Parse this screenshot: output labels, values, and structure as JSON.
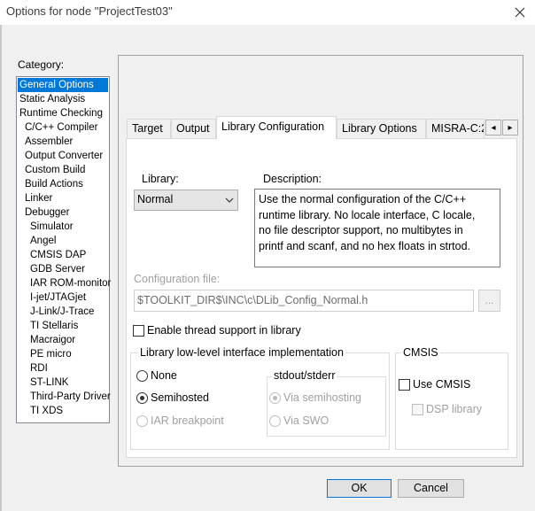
{
  "window": {
    "title": "Options for node \"ProjectTest03\"",
    "close_icon": "close-icon"
  },
  "category": {
    "label": "Category:",
    "items": [
      {
        "label": "General Options",
        "selected": true
      },
      {
        "label": "Static Analysis"
      },
      {
        "label": "Runtime Checking"
      },
      {
        "label": "C/C++ Compiler"
      },
      {
        "label": "Assembler"
      },
      {
        "label": "Output Converter"
      },
      {
        "label": "Custom Build"
      },
      {
        "label": "Build Actions"
      },
      {
        "label": "Linker"
      },
      {
        "label": "Debugger"
      },
      {
        "label": "Simulator"
      },
      {
        "label": "Angel"
      },
      {
        "label": "CMSIS DAP"
      },
      {
        "label": "GDB Server"
      },
      {
        "label": "IAR ROM-monitor"
      },
      {
        "label": "I-jet/JTAGjet"
      },
      {
        "label": "J-Link/J-Trace"
      },
      {
        "label": "TI Stellaris"
      },
      {
        "label": "Macraigor"
      },
      {
        "label": "PE micro"
      },
      {
        "label": "RDI"
      },
      {
        "label": "ST-LINK"
      },
      {
        "label": "Third-Party Driver"
      },
      {
        "label": "TI XDS"
      }
    ]
  },
  "tabs": {
    "items": [
      "Target",
      "Output",
      "Library Configuration",
      "Library Options",
      "MISRA-C:2"
    ],
    "active": "Library Configuration",
    "scroll_left": "◂",
    "scroll_right": "▸"
  },
  "library": {
    "label": "Library:",
    "selected": "Normal",
    "description_label": "Description:",
    "description_lines": [
      "Use the normal configuration of the C/C++",
      "runtime library. No locale interface, C locale,",
      "no file descriptor support, no multibytes in",
      "printf and scanf, and no hex floats in strtod."
    ]
  },
  "config_file": {
    "label": "Configuration file:",
    "value": "$TOOLKIT_DIR$\\INC\\c\\DLib_Config_Normal.h",
    "browse_label": "..."
  },
  "thread_support": {
    "label": "Enable thread support in library",
    "checked": false
  },
  "lowlevel": {
    "title": "Library low-level interface implementation",
    "options": [
      "None",
      "Semihosted",
      "IAR breakpoint"
    ],
    "selected": "Semihosted",
    "stdout": {
      "title": "stdout/stderr",
      "options": [
        "Via semihosting",
        "Via SWO"
      ],
      "selected": "Via semihosting"
    }
  },
  "cmsis": {
    "title": "CMSIS",
    "use_cmsis_label": "Use CMSIS",
    "dsp_label": "DSP library"
  },
  "buttons": {
    "ok": "OK",
    "cancel": "Cancel"
  },
  "colors": {
    "selection": "#0078d7",
    "disabled_text": "#a0a0a0"
  }
}
